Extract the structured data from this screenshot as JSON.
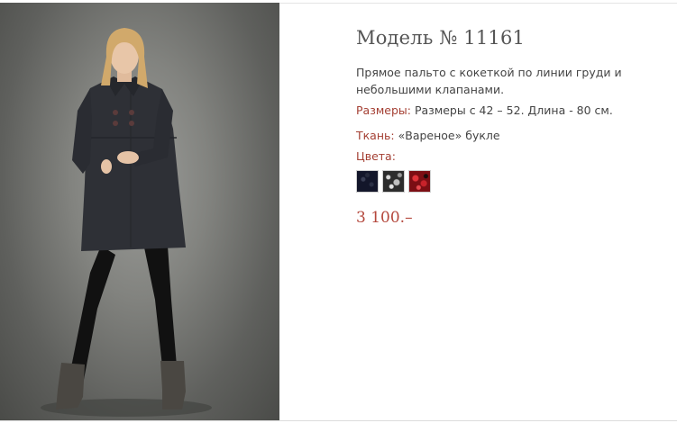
{
  "product": {
    "title": "Модель № 11161",
    "description": "Прямое пальто с кокеткой по линии груди и небольшими клапанами.",
    "sizes_label": "Размеры:",
    "sizes_value": "Размеры с 42 – 52. Длина - 80 см.",
    "fabric_label": "Ткань:",
    "fabric_value": "«Вареное» букле",
    "colors_label": "Цвета:",
    "colors": [
      {
        "name": "navy-boucle",
        "color": "#13162a"
      },
      {
        "name": "grey-black-boucle",
        "color": "#2c2c2c"
      },
      {
        "name": "red-black-boucle",
        "color": "#7c0e14"
      }
    ],
    "price": "3 100.–"
  },
  "theme": {
    "label_color": "#a43f33",
    "price_color": "#b4473c",
    "text_color": "#444444",
    "title_color": "#555555"
  }
}
